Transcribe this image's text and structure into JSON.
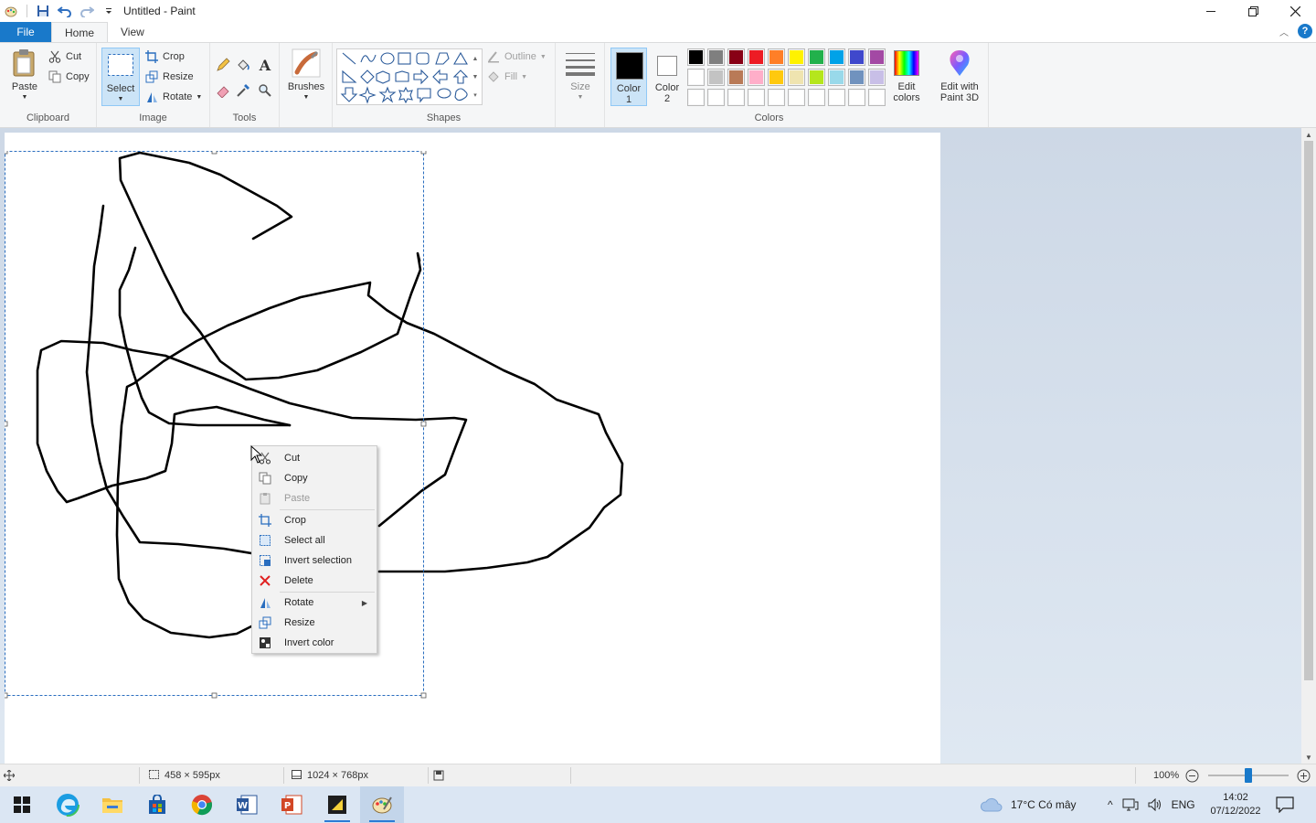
{
  "window": {
    "title": "Untitled - Paint"
  },
  "tabs": {
    "file": "File",
    "home": "Home",
    "view": "View"
  },
  "ribbon": {
    "clipboard": {
      "label": "Clipboard",
      "paste": "Paste",
      "cut": "Cut",
      "copy": "Copy"
    },
    "image": {
      "label": "Image",
      "select": "Select",
      "crop": "Crop",
      "resize": "Resize",
      "rotate": "Rotate"
    },
    "tools": {
      "label": "Tools"
    },
    "brushes": {
      "label": "Brushes"
    },
    "shapes": {
      "label": "Shapes",
      "outline": "Outline",
      "fill": "Fill"
    },
    "size": {
      "label": "Size"
    },
    "colors": {
      "label": "Colors",
      "color1": "Color",
      "color1_num": "1",
      "color2": "Color",
      "color2_num": "2",
      "edit_colors_1": "Edit",
      "edit_colors_2": "colors",
      "edit_3d_1": "Edit with",
      "edit_3d_2": "Paint 3D",
      "color1_value": "#000000",
      "color2_value": "#ffffff",
      "palette_row1": [
        "#000000",
        "#7f7f7f",
        "#880015",
        "#ed1c24",
        "#ff7f27",
        "#fff200",
        "#22b14c",
        "#00a2e8",
        "#3f48cc",
        "#a349a4"
      ],
      "palette_row2": [
        "#ffffff",
        "#c3c3c3",
        "#b97a57",
        "#ffaec9",
        "#ffc90e",
        "#efe4b0",
        "#b5e61d",
        "#99d9ea",
        "#7092be",
        "#c8bfe7"
      ],
      "palette_row3": [
        "#ffffff",
        "#ffffff",
        "#ffffff",
        "#ffffff",
        "#ffffff",
        "#ffffff",
        "#ffffff",
        "#ffffff",
        "#ffffff",
        "#ffffff"
      ]
    }
  },
  "context_menu": {
    "cut": "Cut",
    "copy": "Copy",
    "paste": "Paste",
    "crop": "Crop",
    "select_all": "Select all",
    "invert_selection": "Invert selection",
    "delete": "Delete",
    "rotate": "Rotate",
    "resize": "Resize",
    "invert_color": "Invert color"
  },
  "status": {
    "selection_size": "458 × 595px",
    "image_size": "1024 × 768px",
    "zoom": "100%",
    "zoom_level_percent": 100
  },
  "taskbar": {
    "weather": "17°C  Có mây",
    "language": "ENG",
    "time": "14:02",
    "date": "07/12/2022"
  }
}
